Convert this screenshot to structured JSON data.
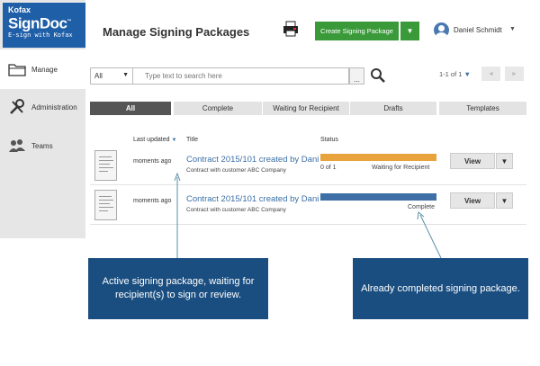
{
  "logo": {
    "line1": "Kofax",
    "line2": "SignDoc",
    "tm": "™",
    "line3": "E-sign with Kofax"
  },
  "sidebar": {
    "items": [
      {
        "label": "Manage",
        "icon": "folder-icon",
        "active": true
      },
      {
        "label": "Administration",
        "icon": "tools-icon",
        "active": false
      },
      {
        "label": "Teams",
        "icon": "team-icon",
        "active": false
      }
    ]
  },
  "header": {
    "title": "Manage Signing Packages",
    "create_label": "Create Signing Package",
    "create_caret": "▼",
    "user_name": "Daniel Schmidt",
    "user_caret": "▼"
  },
  "search": {
    "filter_value": "All",
    "filter_caret": "▼",
    "placeholder": "Type text to search here",
    "more_label": "...",
    "pager_text": "1-1 of 1",
    "pager_caret": "▼",
    "prev": "◄",
    "next": "►"
  },
  "tabs": [
    "All",
    "Complete",
    "Waiting for Recipient",
    "Drafts",
    "Templates"
  ],
  "table": {
    "headers": {
      "last_updated": "Last updated",
      "sort": "▼",
      "title": "Title",
      "status": "Status"
    },
    "rows": [
      {
        "last_updated": "moments ago",
        "title": "Contract 2015/101 created by Dani...",
        "subtitle": "Contract with customer ABC Company",
        "status_left": "0 of 1",
        "status_right": "Waiting for Recipient",
        "status_color": "#e8a33c",
        "view_label": "View",
        "view_caret": "▼"
      },
      {
        "last_updated": "moments ago",
        "title": "Contract 2015/101 created by Dani...",
        "subtitle": "Contract with customer ABC Company",
        "status_left": "",
        "status_right": "Complete",
        "status_color": "#3d6ea5",
        "view_label": "View",
        "view_caret": "▼"
      }
    ]
  },
  "callouts": {
    "active": "Active signing package, waiting for recipient(s) to sign or review.",
    "completed": "Already completed signing package."
  },
  "colors": {
    "brand": "#1f5fa8",
    "accent_green": "#3a9a3a",
    "callout": "#1a4e80"
  }
}
